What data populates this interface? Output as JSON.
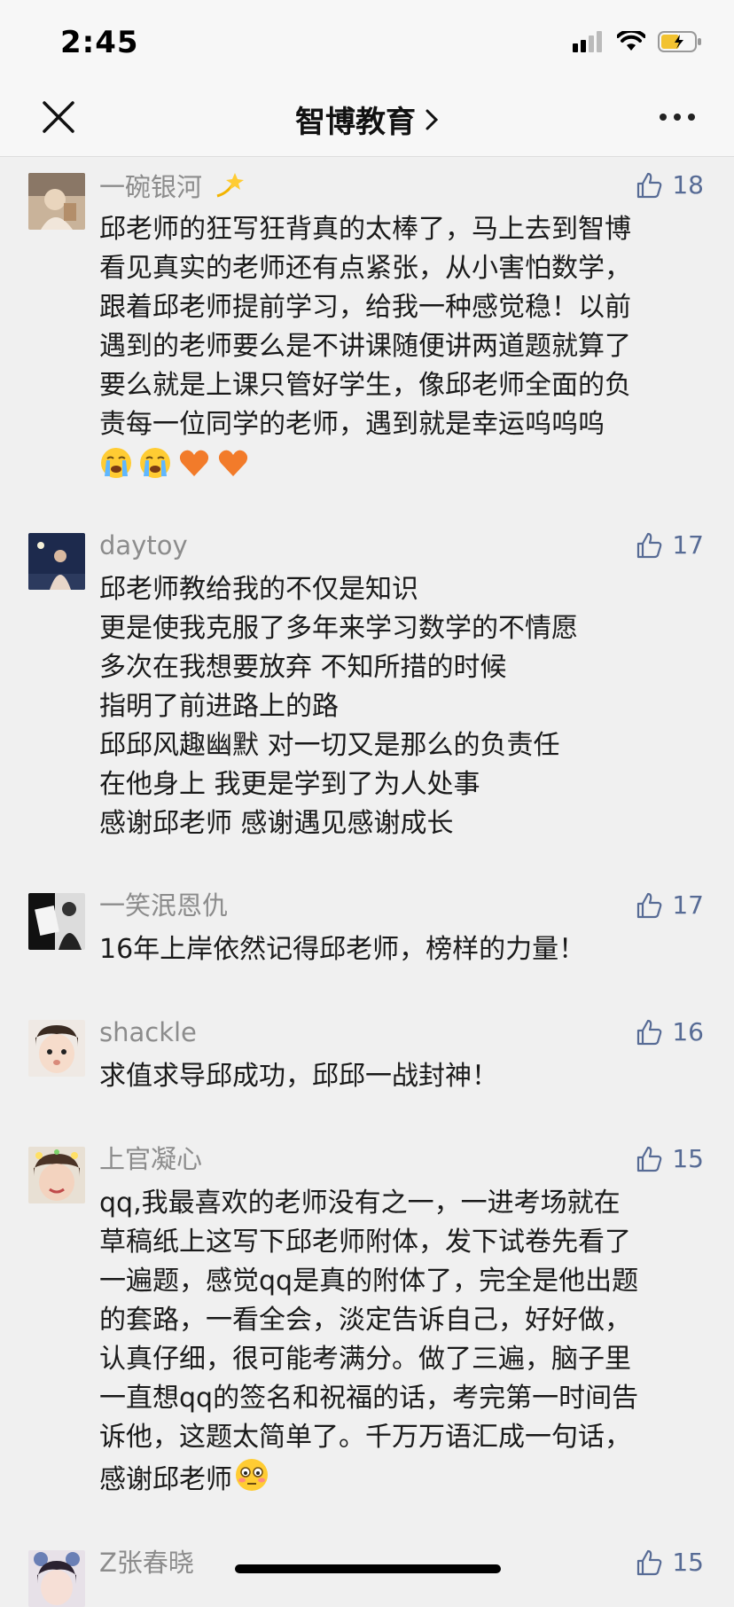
{
  "status_bar": {
    "time": "2:45"
  },
  "nav": {
    "title": "智博教育"
  },
  "comments": [
    {
      "nickname": "一碗银河",
      "likes": "18",
      "text": "邱老师的狂写狂背真的太棒了，马上去到智博\n看见真实的老师还有点紧张，从小害怕数学，\n跟着邱老师提前学习，给我一种感觉稳！以前\n遇到的老师要么是不讲课随便讲两道题就算了\n要么就是上课只管好学生，像邱老师全面的负\n责每一位同学的老师，遇到就是幸运呜呜呜"
    },
    {
      "nickname": "daytoy",
      "likes": "17",
      "text": "邱老师教给我的不仅是知识\n更是使我克服了多年来学习数学的不情愿\n多次在我想要放弃 不知所措的时候\n指明了前进路上的路\n邱邱风趣幽默 对一切又是那么的负责任\n在他身上 我更是学到了为人处事\n感谢邱老师 感谢遇见感谢成长"
    },
    {
      "nickname": "一笑泯恩仇",
      "likes": "17",
      "text": "16年上岸依然记得邱老师，榜样的力量！"
    },
    {
      "nickname": "shackle",
      "likes": "16",
      "text": "求值求导邱成功，邱邱一战封神！"
    },
    {
      "nickname": "上官凝心",
      "likes": "15",
      "text": "qq,我最喜欢的老师没有之一，一进考场就在\n草稿纸上这写下邱老师附体，发下试卷先看了\n一遍题，感觉qq是真的附体了，完全是他出题\n的套路，一看全会，淡定告诉自己，好好做，\n认真仔细，很可能考满分。做了三遍，脑子里\n一直想qq的签名和祝福的话，考完第一时间告\n诉他，这题太简单了。千万万语汇成一句话，\n感谢邱老师"
    },
    {
      "nickname": "Z张春晓",
      "likes": "15",
      "text": ""
    }
  ],
  "colors": {
    "like_blue": "#576b95",
    "nickname_gray": "#8c8c8c",
    "background": "#f0f0f0"
  }
}
